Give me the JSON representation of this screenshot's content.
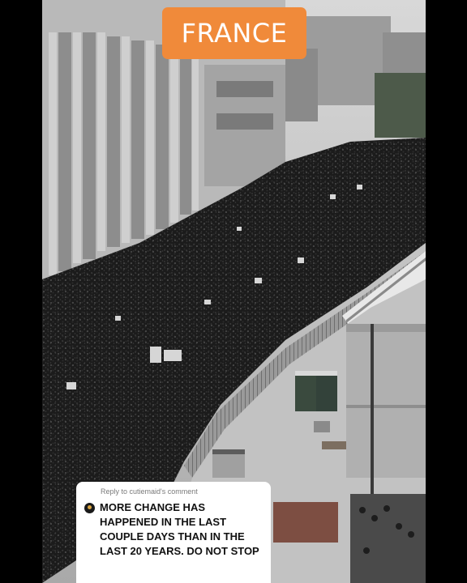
{
  "overlay": {
    "location_tag": "FRANCE",
    "location_tag_color": "#f08a3a"
  },
  "comment": {
    "reply_label": "Reply to cutiemaid's comment",
    "text": "MORE CHANGE HAS HAPPENED IN THE LAST COUPLE DAYS THAN IN THE LAST 20 YEARS. DO NOT STOP"
  }
}
